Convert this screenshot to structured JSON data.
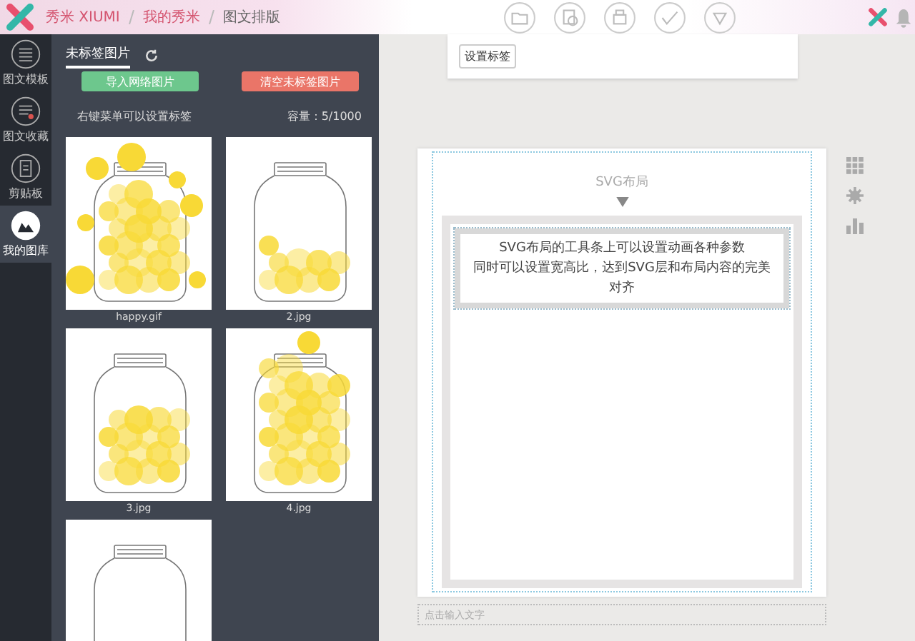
{
  "header": {
    "breadcrumb": [
      "秀米 XIUMI",
      "我的秀米",
      "图文排版"
    ]
  },
  "sidebar": {
    "items": [
      {
        "label": "图文模板",
        "kind": "template",
        "selected": false
      },
      {
        "label": "图文收藏",
        "kind": "favorite",
        "selected": false
      },
      {
        "label": "剪贴板",
        "kind": "clipboard",
        "selected": false
      },
      {
        "label": "我的图库",
        "kind": "gallery",
        "selected": true
      }
    ]
  },
  "panel": {
    "tabs": [
      {
        "label": "未标签图片",
        "selected": true
      }
    ],
    "buttons": [
      {
        "label": "导入网络图片",
        "kind": "import"
      },
      {
        "label": "清空未标签图片",
        "kind": "clear"
      }
    ],
    "hint": "右键菜单可以设置标签",
    "capacity": "容量：5/1000",
    "images": [
      {
        "caption": "happy.gif",
        "kind": "burst"
      },
      {
        "caption": "2.jpg",
        "kind": "few"
      },
      {
        "caption": "3.jpg",
        "kind": "some"
      },
      {
        "caption": "4.jpg",
        "kind": "full"
      },
      {
        "kind": "empty"
      }
    ]
  },
  "editor": {
    "tag_button": "设置标签",
    "svg_title": "SVG布局",
    "note_lines": [
      "SVG布局的工具条上可以设置动画各种参数",
      "同时可以设置宽高比，达到SVG层和布局内容的完美对齐"
    ],
    "input": {
      "placeholder": "点击输入文字"
    }
  }
}
